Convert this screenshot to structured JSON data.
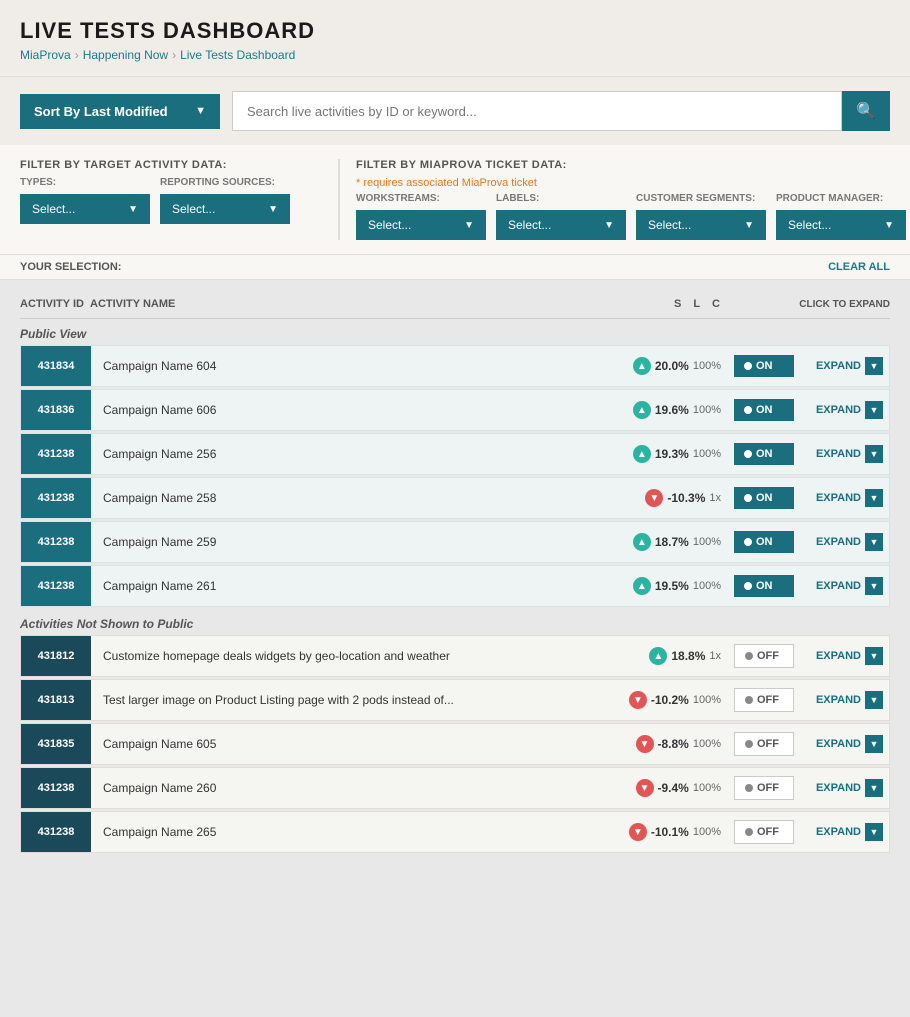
{
  "header": {
    "title": "LIVE TESTS DASHBOARD",
    "breadcrumbs": [
      {
        "label": "MiaProva",
        "link": true
      },
      {
        "label": "Happening Now",
        "link": true
      },
      {
        "label": "Live Tests Dashboard",
        "link": true,
        "current": true
      }
    ]
  },
  "toolbar": {
    "sort_label": "Sort By Last Modified",
    "search_placeholder": "Search live activities by ID or keyword..."
  },
  "filters": {
    "target_label": "Filter by Target Activity Data:",
    "ticket_label": "Filter by MiaProva Ticket Data:",
    "ticket_note": "* requires associated MiaProva ticket",
    "types_label": "TYPES:",
    "reporting_label": "REPORTING SOURCES:",
    "workstreams_label": "WORKSTREAMS:",
    "labels_label": "LABELS:",
    "segments_label": "CUSTOMER SEGMENTS:",
    "product_label": "PRODUCT MANAGER:",
    "dropdowns": [
      {
        "id": "types",
        "placeholder": "Select..."
      },
      {
        "id": "reporting",
        "placeholder": "Select..."
      },
      {
        "id": "workstreams",
        "placeholder": "Select..."
      },
      {
        "id": "labels",
        "placeholder": "Select..."
      },
      {
        "id": "segments",
        "placeholder": "Select..."
      },
      {
        "id": "product_mgr",
        "placeholder": "Select..."
      }
    ],
    "your_selection_label": "YOUR SELECTION:",
    "clear_all_label": "CLEAR ALL"
  },
  "table": {
    "headers": {
      "activity_id": "ACTIVITY ID",
      "activity_name": "ACTIVITY NAME",
      "s": "S",
      "l": "L",
      "c": "C",
      "click_to_expand": "CLICK TO EXPAND"
    },
    "sections": [
      {
        "label": "Public View",
        "rows": [
          {
            "id": "431834",
            "name": "Campaign Name 604",
            "trend": "up",
            "percent": "20.0%",
            "secondary": "100%",
            "status": "ON",
            "id_dark": false
          },
          {
            "id": "431836",
            "name": "Campaign Name 606",
            "trend": "up",
            "percent": "19.6%",
            "secondary": "100%",
            "status": "ON",
            "id_dark": false
          },
          {
            "id": "431238",
            "name": "Campaign Name 256",
            "trend": "up",
            "percent": "19.3%",
            "secondary": "100%",
            "status": "ON",
            "id_dark": false
          },
          {
            "id": "431238",
            "name": "Campaign Name 258",
            "trend": "down",
            "percent": "-10.3%",
            "secondary": "1x",
            "status": "ON",
            "id_dark": false
          },
          {
            "id": "431238",
            "name": "Campaign Name 259",
            "trend": "up",
            "percent": "18.7%",
            "secondary": "100%",
            "status": "ON",
            "id_dark": false
          },
          {
            "id": "431238",
            "name": "Campaign Name 261",
            "trend": "up",
            "percent": "19.5%",
            "secondary": "100%",
            "status": "ON",
            "id_dark": false
          }
        ]
      },
      {
        "label": "Activities Not Shown to Public",
        "rows": [
          {
            "id": "431812",
            "name": "Customize homepage deals widgets by geo-location and weather",
            "trend": "up",
            "percent": "18.8%",
            "secondary": "1x",
            "status": "OFF",
            "id_dark": true
          },
          {
            "id": "431813",
            "name": "Test larger image on Product Listing page with 2 pods instead of...",
            "trend": "down",
            "percent": "-10.2%",
            "secondary": "100%",
            "status": "OFF",
            "id_dark": true
          },
          {
            "id": "431835",
            "name": "Campaign Name 605",
            "trend": "down",
            "percent": "-8.8%",
            "secondary": "100%",
            "status": "OFF",
            "id_dark": true
          },
          {
            "id": "431238",
            "name": "Campaign Name 260",
            "trend": "down",
            "percent": "-9.4%",
            "secondary": "100%",
            "status": "OFF",
            "id_dark": true
          },
          {
            "id": "431238",
            "name": "Campaign Name 265",
            "trend": "down",
            "percent": "-10.1%",
            "secondary": "100%",
            "status": "OFF",
            "id_dark": true
          }
        ]
      }
    ]
  }
}
